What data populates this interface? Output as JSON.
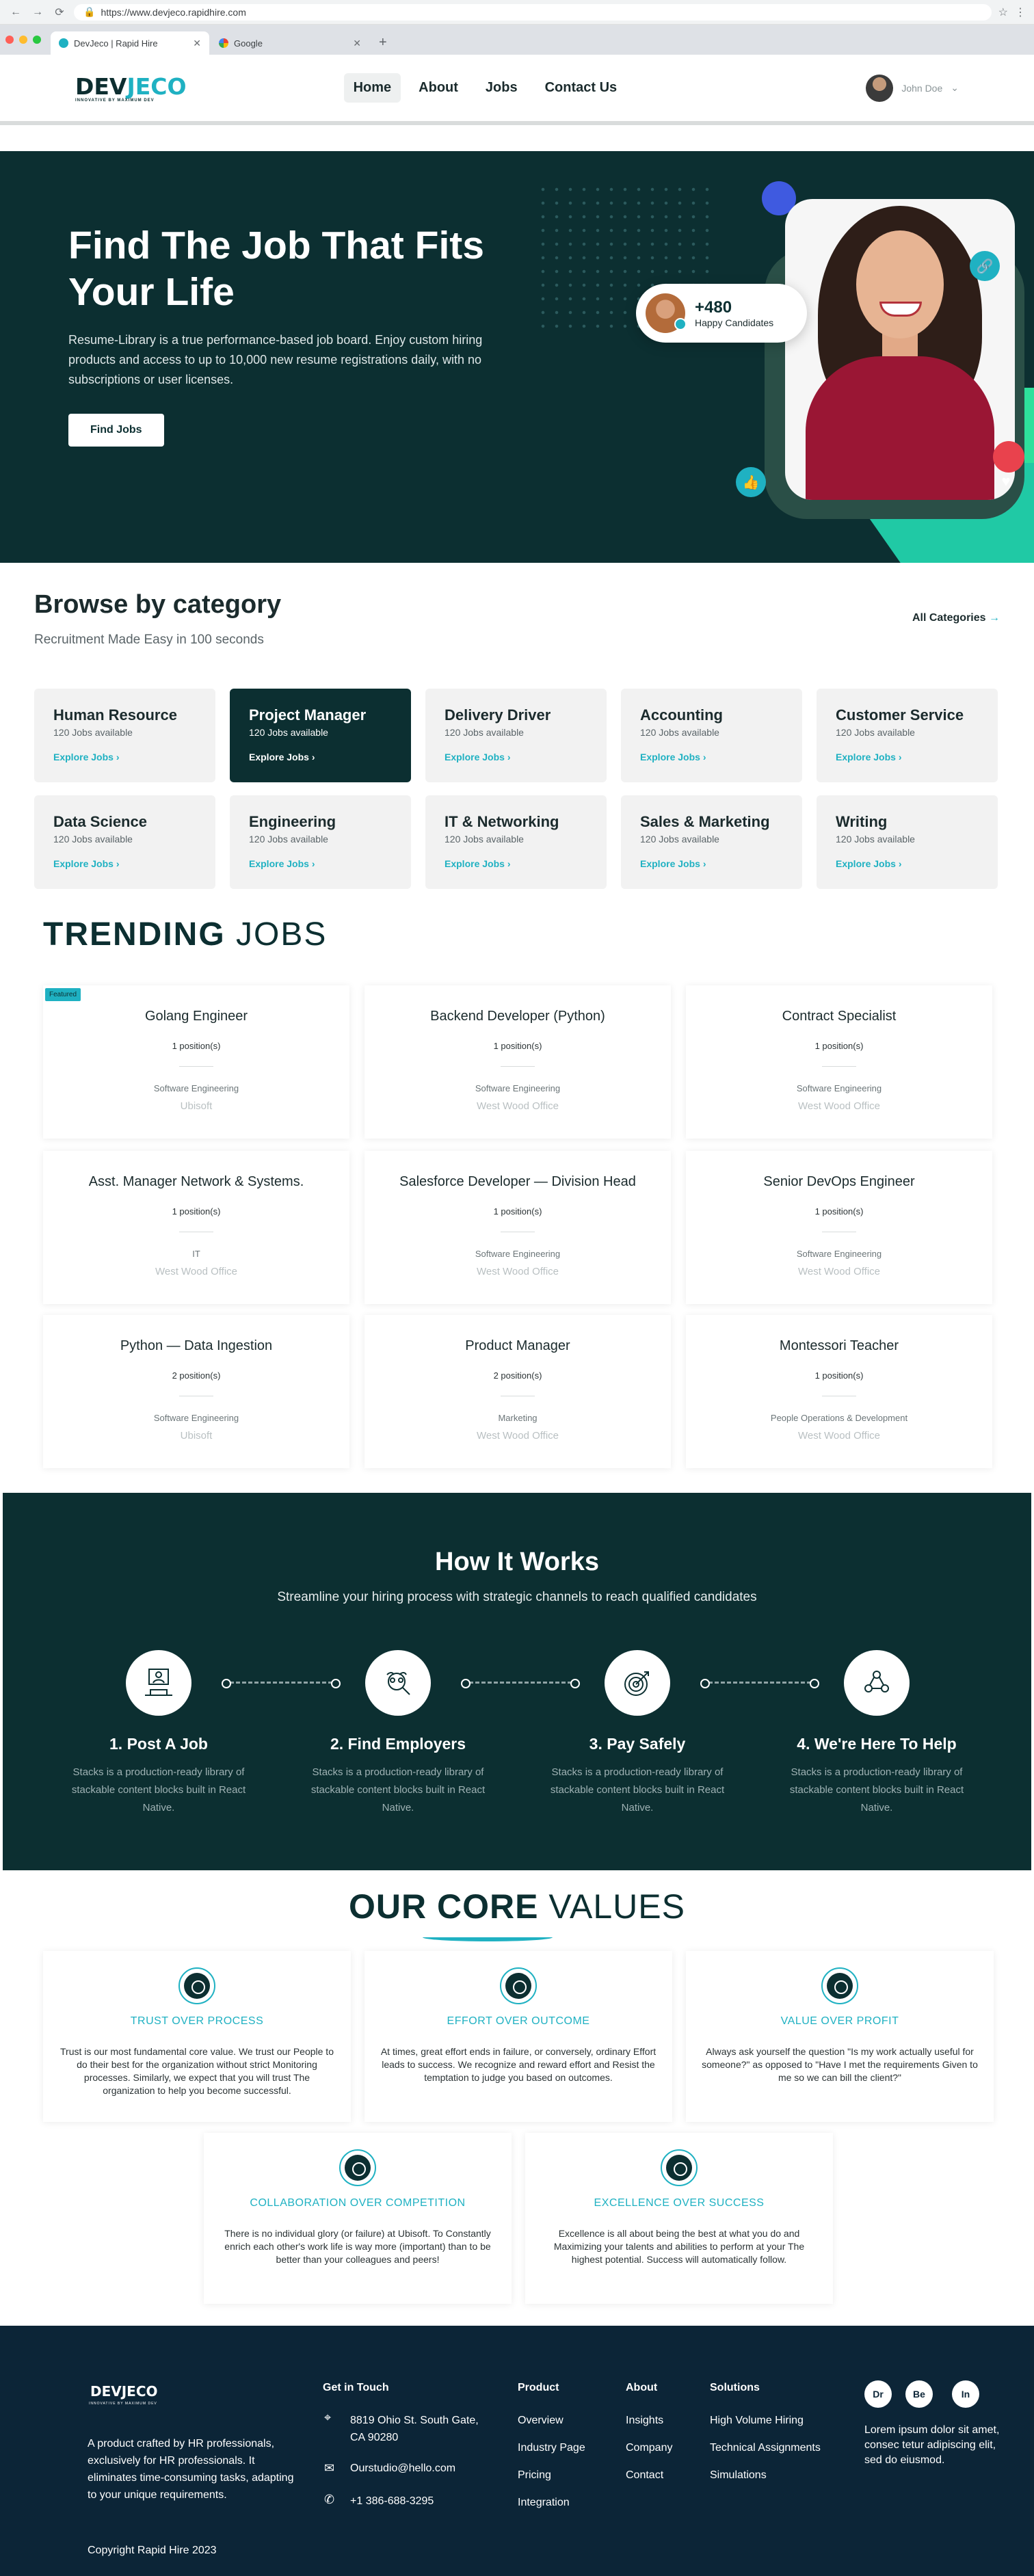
{
  "browser": {
    "url": "https://www.devjeco.rapidhire.com",
    "tabs": [
      {
        "label": "DevJeco | Rapid Hire"
      },
      {
        "label": "Google"
      }
    ]
  },
  "header": {
    "logo_main": "DEV",
    "logo_accent": "JECO",
    "logo_tagline": "INNOVATIVE BY MAXIMUM DEV",
    "nav": [
      {
        "label": "Home"
      },
      {
        "label": "About"
      },
      {
        "label": "Jobs"
      },
      {
        "label": "Contact Us"
      }
    ],
    "user_name": "John Doe"
  },
  "hero": {
    "title": "Find The Job That Fits Your Life",
    "description": "Resume-Library is a true performance-based job board. Enjoy custom hiring products and access to up to 10,000 new resume registrations daily, with no subscriptions or user licenses.",
    "button": "Find Jobs",
    "candidates_count": "+480",
    "candidates_label": "Happy Candidates"
  },
  "category": {
    "title": "Browse by category",
    "subtitle": "Recruitment Made Easy in 100 seconds",
    "all_link": "All Categories",
    "items": [
      {
        "title": "Human Resource",
        "count": "120 Jobs available",
        "link": "Explore Jobs"
      },
      {
        "title": "Project Manager",
        "count": "120 Jobs available",
        "link": "Explore Jobs"
      },
      {
        "title": "Delivery Driver",
        "count": "120 Jobs available",
        "link": "Explore Jobs"
      },
      {
        "title": "Accounting",
        "count": "120 Jobs available",
        "link": "Explore Jobs"
      },
      {
        "title": "Customer Service",
        "count": "120 Jobs available",
        "link": "Explore Jobs"
      },
      {
        "title": "Data Science",
        "count": "120 Jobs available",
        "link": "Explore Jobs"
      },
      {
        "title": "Engineering",
        "count": "120 Jobs available",
        "link": "Explore Jobs"
      },
      {
        "title": "IT & Networking",
        "count": "120 Jobs available",
        "link": "Explore Jobs"
      },
      {
        "title": "Sales & Marketing",
        "count": "120 Jobs available",
        "link": "Explore Jobs"
      },
      {
        "title": "Writing",
        "count": "120 Jobs available",
        "link": "Explore Jobs"
      }
    ]
  },
  "trending": {
    "title_bold": "TRENDING",
    "title_light": "JOBS",
    "featured_label": "Featured",
    "jobs": [
      {
        "title": "Golang Engineer",
        "positions": "1 position(s)",
        "dept": "Software Engineering",
        "office": "Ubisoft"
      },
      {
        "title": "Backend Developer (Python)",
        "positions": "1 position(s)",
        "dept": "Software Engineering",
        "office": "West Wood Office"
      },
      {
        "title": "Contract Specialist",
        "positions": "1 position(s)",
        "dept": "Software Engineering",
        "office": "West Wood Office"
      },
      {
        "title": "Asst. Manager Network & Systems.",
        "positions": "1 position(s)",
        "dept": "IT",
        "office": "West Wood Office"
      },
      {
        "title": "Salesforce Developer — Division Head",
        "positions": "1 position(s)",
        "dept": "Software Engineering",
        "office": "West Wood Office"
      },
      {
        "title": "Senior DevOps Engineer",
        "positions": "1 position(s)",
        "dept": "Software Engineering",
        "office": "West Wood Office"
      },
      {
        "title": "Python — Data Ingestion",
        "positions": "2 position(s)",
        "dept": "Software Engineering",
        "office": "Ubisoft"
      },
      {
        "title": "Product Manager",
        "positions": "2 position(s)",
        "dept": "Marketing",
        "office": "West Wood Office"
      },
      {
        "title": "Montessori Teacher",
        "positions": "1 position(s)",
        "dept": "People Operations & Development",
        "office": "West Wood Office"
      }
    ]
  },
  "how": {
    "title": "How It Works",
    "subtitle": "Streamline your hiring process with strategic channels to reach qualified candidates",
    "steps": [
      {
        "title": "1. Post A Job",
        "desc": "Stacks is a production-ready library of stackable content blocks built in React Native."
      },
      {
        "title": "2. Find Employers",
        "desc": "Stacks is a production-ready library of stackable content blocks built in React Native."
      },
      {
        "title": "3. Pay Safely",
        "desc": "Stacks is a production-ready library of stackable content blocks built in React Native."
      },
      {
        "title": "4. We're Here To Help",
        "desc": "Stacks is a production-ready library of stackable content blocks built in React Native."
      }
    ]
  },
  "core": {
    "title_bold": "OUR CORE",
    "title_light": "VALUES",
    "values": [
      {
        "title": "TRUST OVER PROCESS",
        "desc": "Trust is our most fundamental core value. We trust our People to do their best for the organization without strict Monitoring processes. Similarly, we expect that you will trust The organization to help you become successful."
      },
      {
        "title": "EFFORT OVER OUTCOME",
        "desc": "At times, great effort ends in failure, or conversely, ordinary Effort leads to success. We recognize and reward effort and Resist the temptation to judge you based on outcomes."
      },
      {
        "title": "VALUE OVER PROFIT",
        "desc": "Always ask yourself the question \"Is my work actually useful for someone?\" as opposed to \"Have I met the requirements Given to me so we can bill the client?\""
      },
      {
        "title": "COLLABORATION OVER COMPETITION",
        "desc": "There is no individual glory (or failure) at Ubisoft. To Constantly enrich each other's work life is way more (important) than to be better than your colleagues and peers!"
      },
      {
        "title": "EXCELLENCE OVER SUCCESS",
        "desc": "Excellence is all about being the best at what you do and Maximizing your talents and abilities to perform at your The highest potential. Success will automatically follow."
      }
    ]
  },
  "footer": {
    "logo": "DEVJECO",
    "tagline": "INNOVATIVE BY MAXIMUM DEV",
    "about": "A product crafted by HR professionals, exclusively for HR professionals. It eliminates time-consuming tasks, adapting to your unique requirements.",
    "contact_heading": "Get in Touch",
    "address": "8819 Ohio St. South Gate, CA 90280",
    "email": "Ourstudio@hello.com",
    "phone": "+1 386-688-3295",
    "product_heading": "Product",
    "product_links": [
      "Overview",
      "Industry Page",
      "Pricing",
      "Integration"
    ],
    "about_heading": "About",
    "about_links": [
      "Insights",
      "Company",
      "Contact"
    ],
    "solutions_heading": "Solutions",
    "solutions_links": [
      "High Volume Hiring",
      "Technical Assignments",
      "Simulations"
    ],
    "social": [
      "Dr",
      "Be",
      "In"
    ],
    "lorem": "Lorem ipsum dolor sit amet, consec tetur adipiscing elit, sed do eiusmod.",
    "copyright": "Copyright Rapid Hire 2023"
  }
}
